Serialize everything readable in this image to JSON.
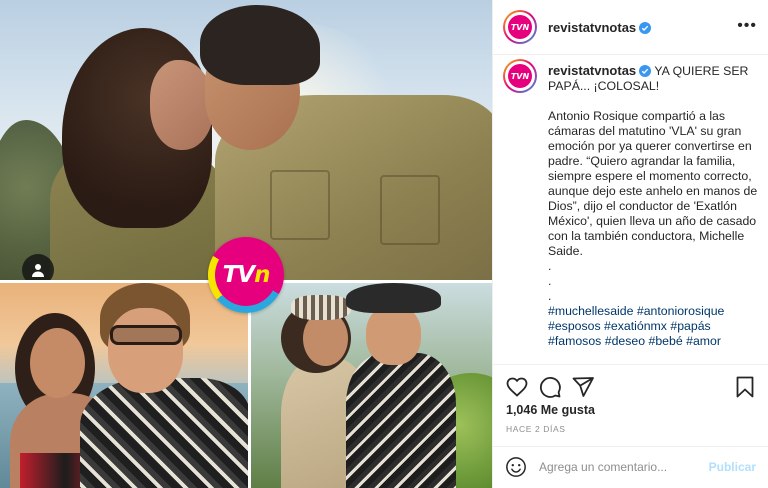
{
  "post": {
    "brand_logo_text": "TVN",
    "username": "revistatvnotas",
    "caption": {
      "headline": "YA QUIERE SER PAPÁ... ¡COLOSAL!",
      "body": "Antonio Rosique compartió a las cámaras del matutino 'VLA' su gran emoción por ya querer convertirse en padre. “Quiero agrandar la familia, siempre espere el momento correcto, aunque dejo este anhelo en manos de Dios”, dijo el conductor de 'Exatlón México', quien lleva un año de casado con la también conductora, Michelle Saide.",
      "dots": [
        ".",
        ".",
        "."
      ],
      "hashtags": "#muchellesaide #antoniorosique #esposos #exatiónmx #papás #famosos #deseo #bebé #amor"
    },
    "likes": "1,046 Me gusta",
    "time_ago": "HACE 2 DÍAS"
  },
  "comment": {
    "placeholder": "Agrega un comentario...",
    "post_label": "Publicar"
  },
  "icons": {
    "verified": "verified-badge-icon",
    "more": "more-options-icon",
    "like": "heart-icon",
    "comment": "comment-bubble-icon",
    "share": "paper-plane-icon",
    "save": "bookmark-icon",
    "emoji": "emoji-smile-icon",
    "tagged_user": "user-tag-icon"
  },
  "colors": {
    "link": "#00376b",
    "verified": "#3897f0",
    "post_disabled": "#b2dffc",
    "brand_magenta": "#e6007e"
  }
}
